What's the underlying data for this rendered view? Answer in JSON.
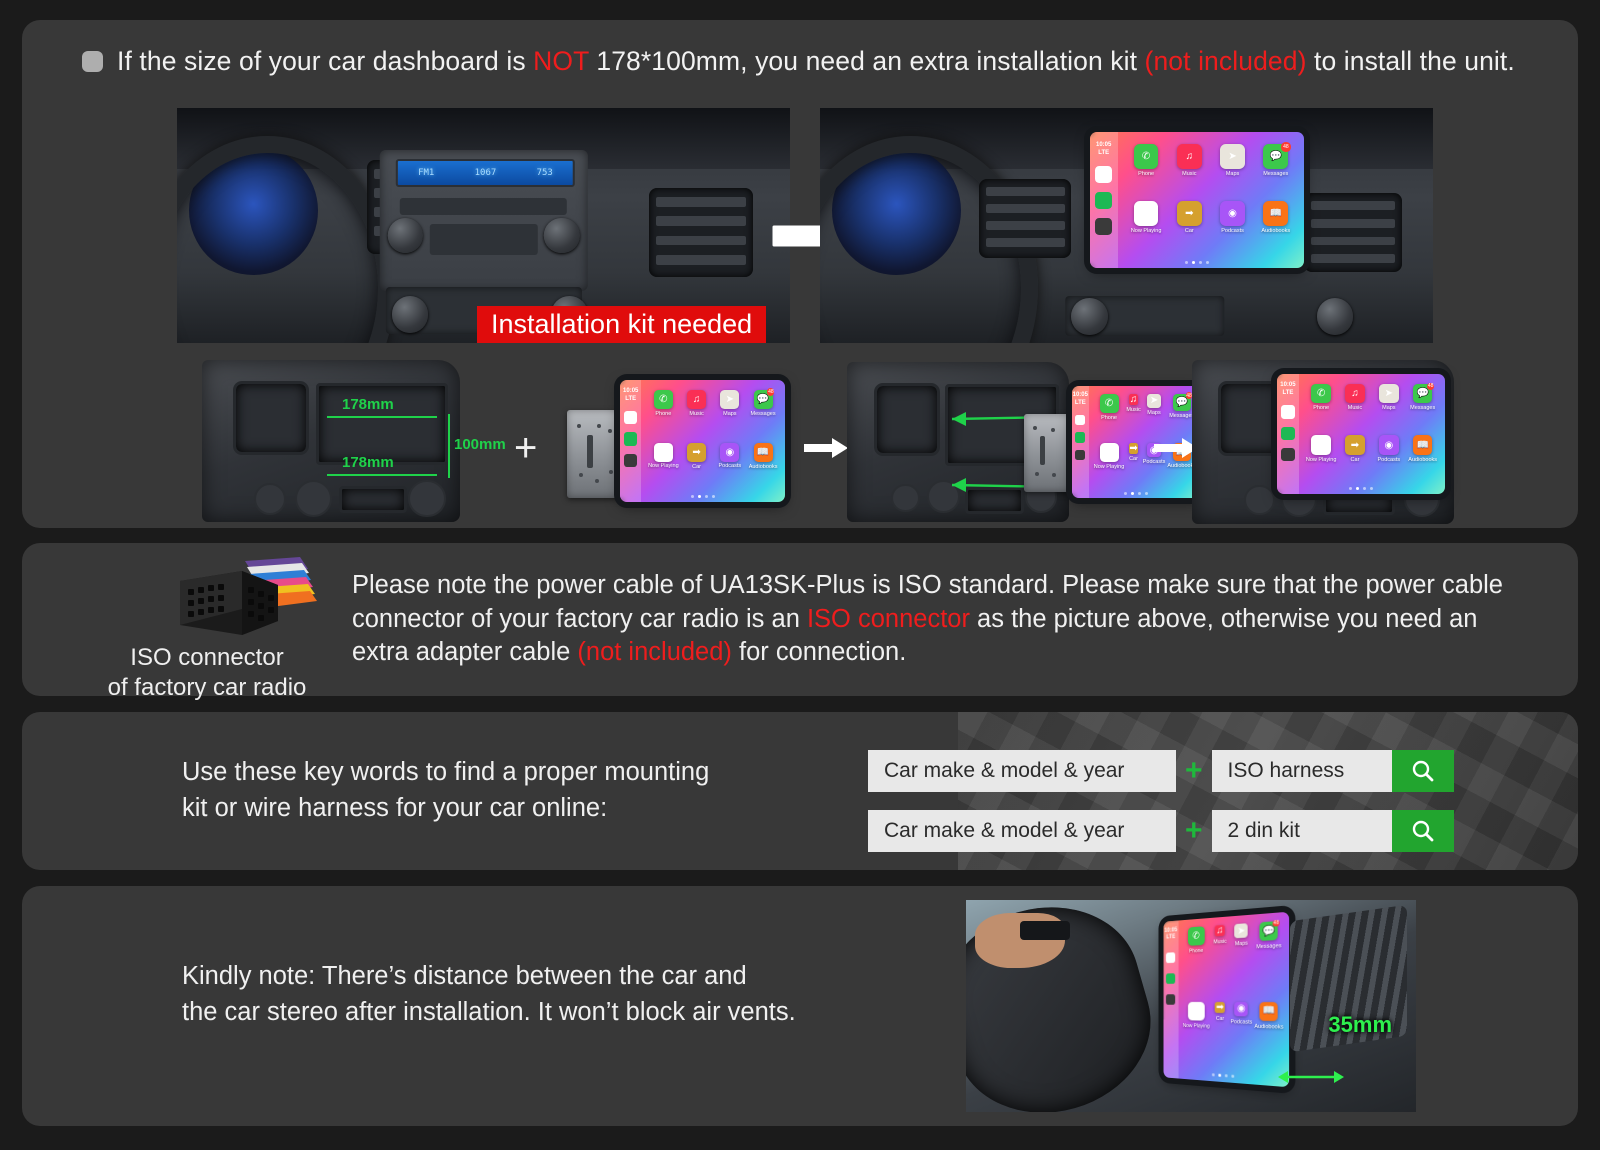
{
  "header": {
    "bullet_icon": "checkbox-square-icon",
    "text_parts": [
      {
        "t": "If the size of your car dashboard is ",
        "c": "white"
      },
      {
        "t": "NOT",
        "c": "red"
      },
      {
        "t": " 178*100mm, you need an extra installation kit ",
        "c": "white"
      },
      {
        "t": "(not included)",
        "c": "red"
      },
      {
        "t": " to install the unit.",
        "c": "white"
      }
    ],
    "full_text": "If the size of your car dashboard is NOT 178*100mm, you need an extra installation kit (not included) to install the unit."
  },
  "dashboards": {
    "before": {
      "alt": "factory car stereo dashboard",
      "radio_display": [
        "FM1",
        "1067",
        "753"
      ],
      "banner": "Installation kit needed"
    },
    "after": {
      "alt": "dashboard with carplay head unit installed"
    },
    "arrow_icon": "right-arrow-icon"
  },
  "carplay": {
    "status_time": "10:05",
    "status_signal": "LTE",
    "apps_row1": [
      {
        "label": "Phone",
        "color": "#3cc84b",
        "glyph": "✆"
      },
      {
        "label": "Music",
        "color": "#fa2f55",
        "glyph": "♫"
      },
      {
        "label": "Maps",
        "color": "#e9e5dc",
        "glyph": "➤"
      },
      {
        "label": "Messages",
        "color": "#3cc84b",
        "glyph": "💬",
        "badge": "48"
      }
    ],
    "apps_row2": [
      {
        "label": "Now Playing",
        "color": "#ffffff",
        "glyph": "‖"
      },
      {
        "label": "Car",
        "color": "#d5a02e",
        "glyph": "➡"
      },
      {
        "label": "Podcasts",
        "color": "#a855f7",
        "glyph": "◉"
      },
      {
        "label": "Audiobooks",
        "color": "#f97316",
        "glyph": "📖"
      }
    ],
    "side_icons": [
      "maps-pin-icon",
      "spotify-icon",
      "settings-icon"
    ]
  },
  "install_steps": {
    "dimensions": {
      "width_top": "178mm",
      "width_bottom": "178mm",
      "height": "100mm"
    },
    "plus_symbol": "+",
    "arrow_icon": "right-arrow-icon",
    "step_labels": [
      "dash-kit-frame",
      "head-unit",
      "insert-unit-into-frame",
      "assembled-unit"
    ]
  },
  "iso": {
    "connector_caption_line1": "ISO connector",
    "connector_caption_line2": "of factory car radio",
    "paragraph_parts": [
      {
        "t": "Please note the power cable of UA13SK-Plus is ISO standard. Please make sure that the power cable connector of your factory car radio is an ",
        "c": "white"
      },
      {
        "t": "ISO connector",
        "c": "red"
      },
      {
        "t": " as the picture above, otherwise you need an extra adapter cable ",
        "c": "white"
      },
      {
        "t": "(not included)",
        "c": "red"
      },
      {
        "t": " for connection.",
        "c": "white"
      }
    ],
    "full_paragraph": "Please note the power cable of UA13SK-Plus is ISO standard. Please make sure that the power cable connector of your factory car radio is an ISO connector as the picture above, otherwise you need an extra adapter cable (not included) for connection.",
    "model": "UA13SK-Plus"
  },
  "keywords": {
    "instruction_line1": "Use these key words to find a proper mounting",
    "instruction_line2": "kit or wire harness for your car online:",
    "rows": [
      {
        "field_a": "Car make & model & year",
        "plus": "+",
        "field_b": "ISO harness",
        "button_icon": "search-icon"
      },
      {
        "field_a": "Car make &  model & year",
        "plus": "+",
        "field_b": "2 din kit",
        "button_icon": "search-icon"
      }
    ]
  },
  "note": {
    "line1": "Kindly note: There’s distance between the car and",
    "line2": "the car stereo after installation. It won’t block air vents.",
    "photo_label": "35mm",
    "photo_alt": "hand on steering wheel with carplay screen installed"
  },
  "colors": {
    "page_bg": "#1b1b1b",
    "panel_bg": "#383838",
    "text": "#f0f0f0",
    "accent_red": "#ef1d1d",
    "accent_green": "#22a52f",
    "dimension_green": "#1fd24a",
    "banner_red": "#e00c0c",
    "field_bg": "#e8e8e8"
  }
}
